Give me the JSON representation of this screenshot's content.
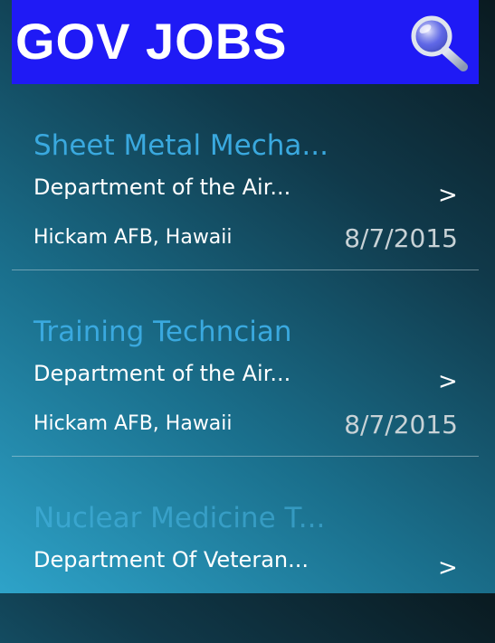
{
  "header": {
    "title": "GOV JOBS",
    "background_color": "#1f1af5",
    "search_icon": "search-icon"
  },
  "jobs": [
    {
      "title": "Sheet Metal Mecha...",
      "department": "Department of the Air...",
      "location": "Hickam AFB, Hawaii",
      "date": "8/7/2015",
      "chevron": ">"
    },
    {
      "title": "Training Techncian",
      "department": "Department of the Air...",
      "location": "Hickam AFB, Hawaii",
      "date": "8/7/2015",
      "chevron": ">"
    },
    {
      "title": "Nuclear Medicine T...",
      "department": "Department Of Veteran...",
      "chevron": ">"
    }
  ],
  "colors": {
    "title_text": "#3aa9df",
    "date_text": "#c8d2d6"
  }
}
